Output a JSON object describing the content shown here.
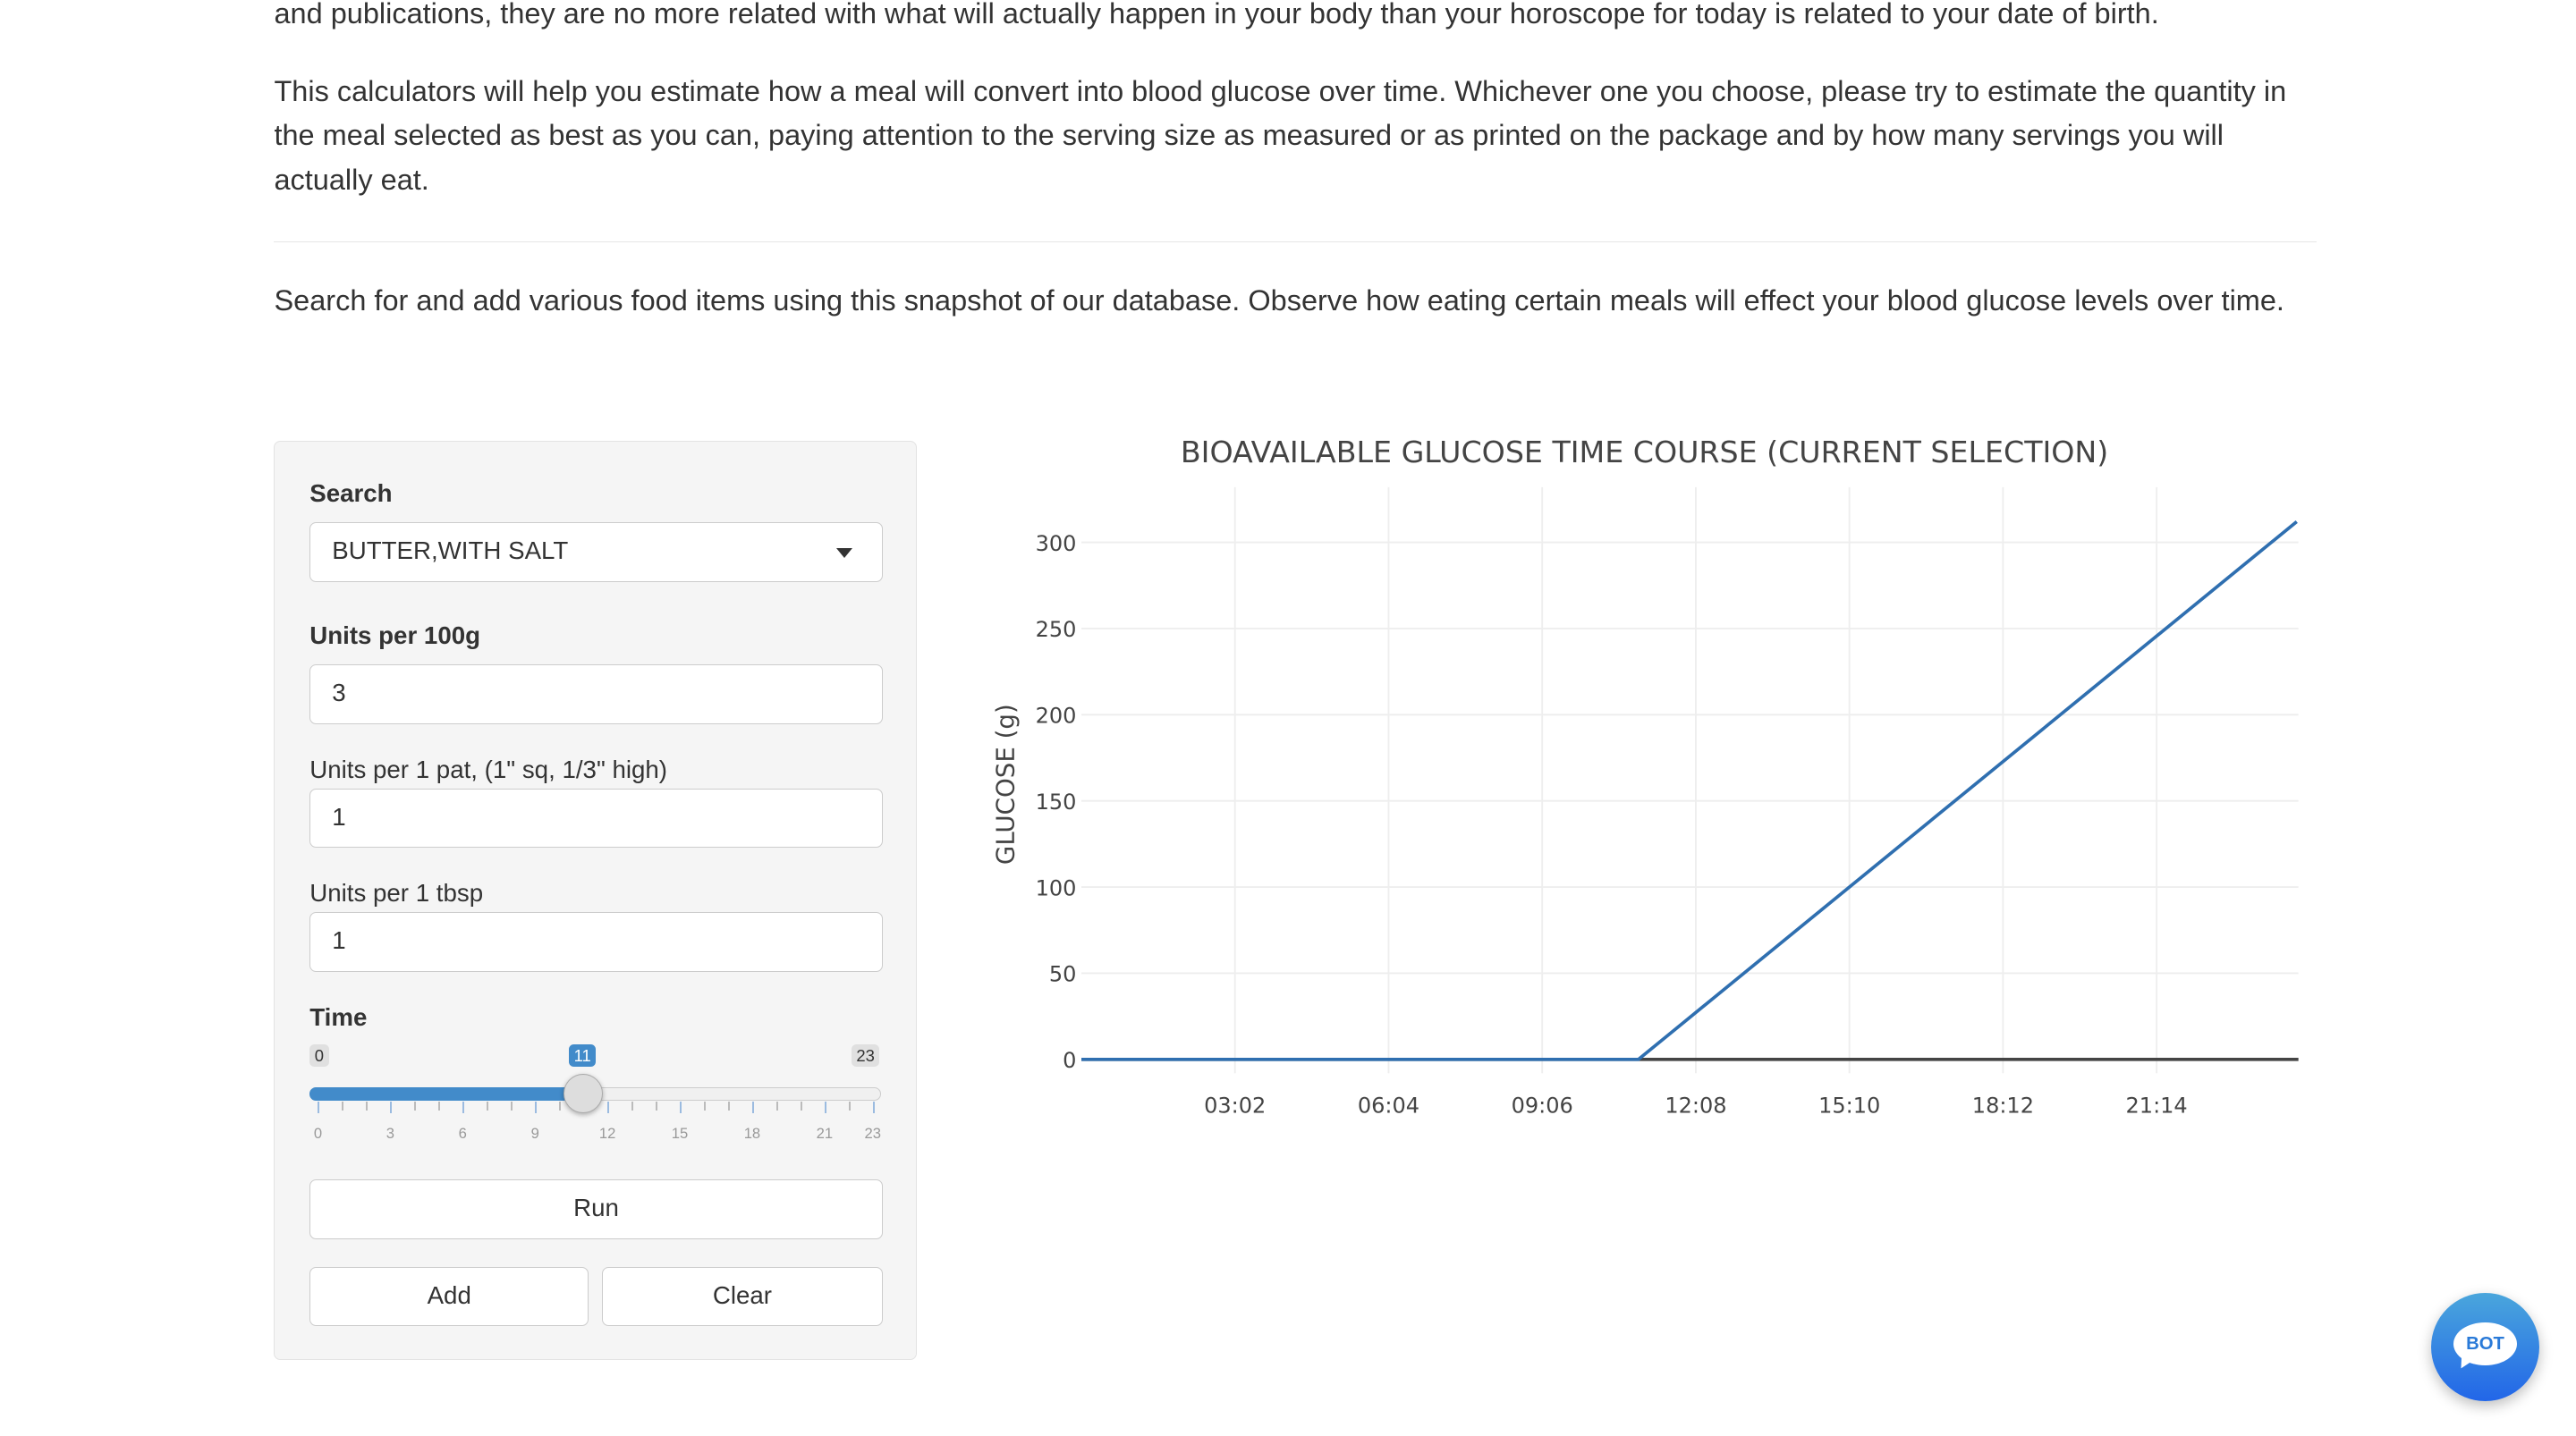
{
  "intro": {
    "p1": "and publications, they are no more related with what will actually happen in your body than your horoscope for today is related to your date of birth.",
    "p2": "This calculators will help you estimate how a meal will convert into blood glucose over time. Whichever one you choose, please try to estimate the quantity in the meal selected as best as you can, paying attention to the serving size as measured or as printed on the package and by how many servings you will actually eat.",
    "p3": "Search for and add various food items using this snapshot of our database. Observe how eating certain meals will effect your blood glucose levels over time."
  },
  "form": {
    "search_label": "Search",
    "search_value": "BUTTER,WITH SALT",
    "units100_label": "Units per 100g",
    "units100_value": "3",
    "unitspat_label": "Units per 1 pat, (1\" sq, 1/3\" high)",
    "unitspat_value": "1",
    "unitstbsp_label": "Units per 1 tbsp",
    "unitstbsp_value": "1",
    "time_label": "Time",
    "time_min": "0",
    "time_max": "23",
    "time_value": "11",
    "time_ticks": [
      "0",
      "3",
      "6",
      "9",
      "12",
      "15",
      "18",
      "21",
      "23"
    ],
    "run_label": "Run",
    "add_label": "Add",
    "clear_label": "Clear"
  },
  "bot_label": "BOT",
  "chart_data": {
    "type": "line",
    "title": "BIOAVAILABLE GLUCOSE TIME COURSE (CURRENT SELECTION)",
    "xlabel": "",
    "ylabel": "GLUCOSE (g)",
    "x_minutes": [
      0,
      660,
      1440
    ],
    "y": [
      0,
      0,
      312
    ],
    "xlim": [
      0,
      1442
    ],
    "ylim": [
      -8,
      332
    ],
    "x_ticks_minutes": [
      182,
      364,
      546,
      728,
      910,
      1092,
      1274
    ],
    "x_tick_labels": [
      "03:02",
      "06:04",
      "09:06",
      "12:08",
      "15:10",
      "18:12",
      "21:14"
    ],
    "y_ticks": [
      0,
      50,
      100,
      150,
      200,
      250,
      300
    ],
    "y_tick_labels": [
      "0",
      "50",
      "100",
      "150",
      "200",
      "250",
      "300"
    ],
    "line_color": "#2f6fb0",
    "grid": true
  }
}
